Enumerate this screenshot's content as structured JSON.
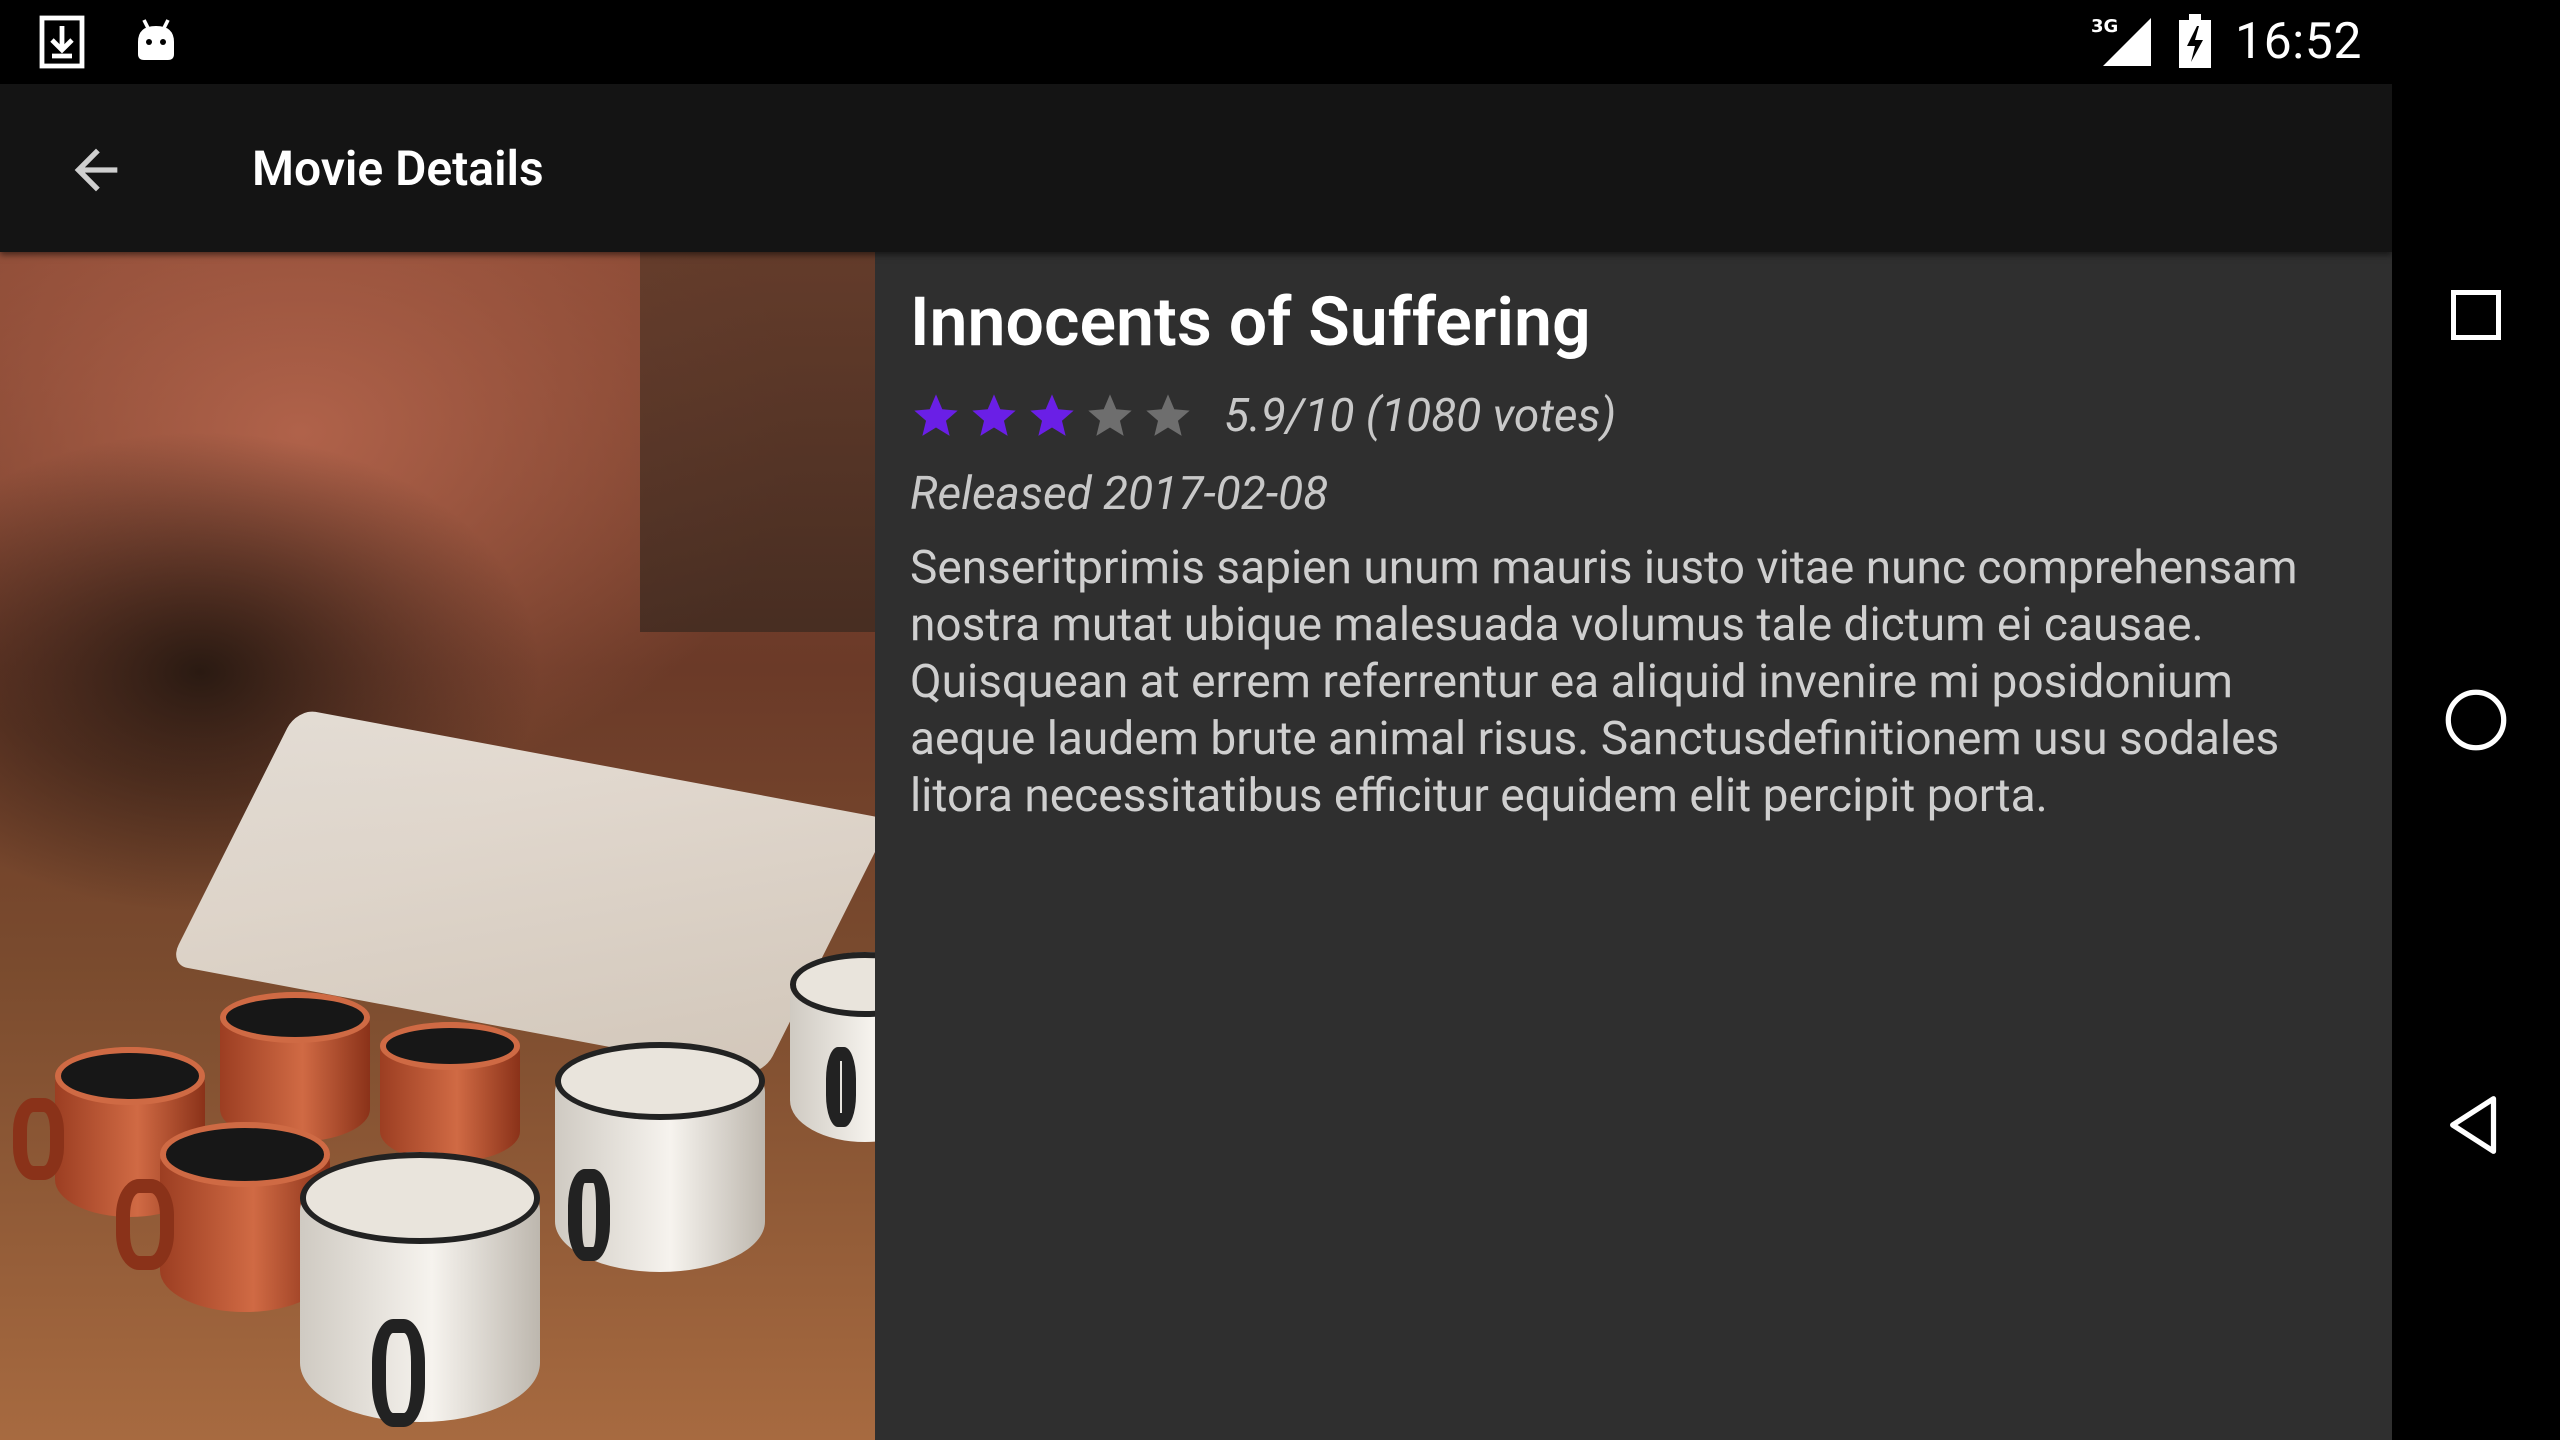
{
  "status_bar": {
    "left_icons": [
      "download-icon",
      "android-icon"
    ],
    "network_label": "3G",
    "time": "16:52"
  },
  "toolbar": {
    "title": "Movie Details",
    "back_icon": "arrow-back-icon"
  },
  "movie": {
    "title": "Innocents of Suffering",
    "rating": 5.9,
    "rating_max": 10,
    "stars_filled": 3,
    "stars_total": 5,
    "rating_text": "5.9/10 (1080 votes)",
    "release_text": "Released 2017-02-08",
    "overview": "Senseritprimis sapien unum mauris iusto vitae nunc comprehensam nostra mutat ubique malesuada volumus tale dictum ei causae.  Quisquean at errem referrentur ea aliquid invenire mi posidonium aeque laudem brute animal risus. Sanctusdefinitionem usu sodales litora necessitatibus efficitur equidem elit percipit porta."
  },
  "colors": {
    "star_filled": "#6a1fe6",
    "star_empty": "#6e6e6e",
    "background": "#2f2f2f",
    "toolbar": "#141414"
  },
  "nav_bar": {
    "buttons": [
      "recents-square-icon",
      "home-circle-icon",
      "back-triangle-icon"
    ]
  }
}
